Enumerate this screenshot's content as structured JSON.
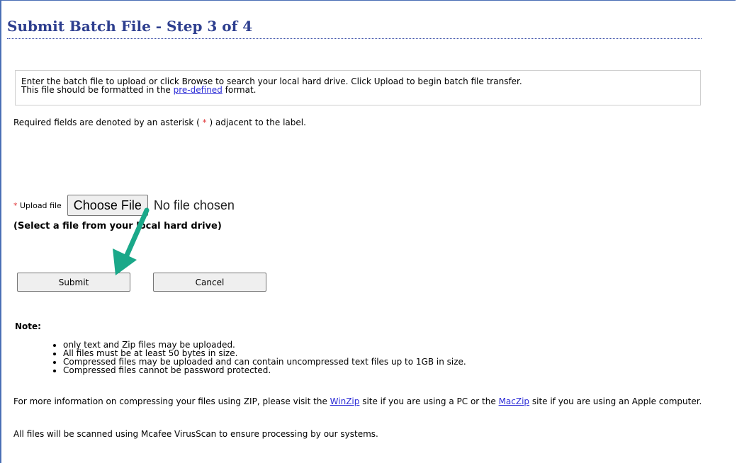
{
  "page": {
    "title": "Submit Batch File - Step 3 of 4"
  },
  "instructions": {
    "line1": "Enter the batch file to upload or click Browse to search your local hard drive. Click Upload to begin batch file transfer.",
    "line2_before": "This file should be formatted in the ",
    "line2_link": "pre-defined",
    "line2_after": " format."
  },
  "required_note": {
    "before": "Required fields are denoted by an asterisk ( ",
    "asterisk": "*",
    "after": " ) adjacent to the label."
  },
  "upload": {
    "asterisk": "*",
    "label": "Upload file",
    "choose_button": "Choose File",
    "status": "No file chosen",
    "hint": "(Select a file from your local hard drive)"
  },
  "buttons": {
    "submit": "Submit",
    "cancel": "Cancel"
  },
  "note": {
    "title": "Note:",
    "items": [
      "only text and Zip files may be uploaded.",
      "All files must be at least 50 bytes in size.",
      "Compressed files may be uploaded and can contain uncompressed text files up to 1GB in size.",
      "Compressed files cannot be password protected."
    ]
  },
  "info": {
    "before": "For more information on compressing your files using ZIP, please visit the ",
    "link1": "WinZip",
    "middle": " site if you are using a PC or the ",
    "link2": "MacZip",
    "after": " site if you are using an Apple computer."
  },
  "scan_text": "All files will be scanned using Mcafee VirusScan to ensure processing by our systems.",
  "colors": {
    "title": "#2e3f8f",
    "asterisk": "#e0383a",
    "link": "#2b2bd6",
    "arrow": "#1aa889"
  },
  "icons": {
    "annotation_arrow": "arrow-down-left-icon"
  }
}
